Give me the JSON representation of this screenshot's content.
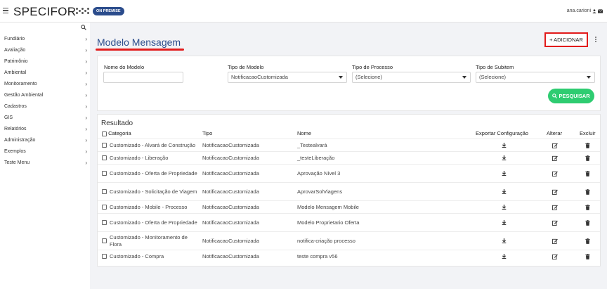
{
  "header": {
    "logo_text": "SPECIFOR",
    "badge": "ON PREMISE",
    "user": "ana.carioni",
    "icons": [
      "menu-icon",
      "user-icon",
      "mail-icon"
    ]
  },
  "sidebar": {
    "items": [
      {
        "label": "Fundiário"
      },
      {
        "label": "Avaliação"
      },
      {
        "label": "Patrimônio"
      },
      {
        "label": "Ambiental"
      },
      {
        "label": "Monitoramento"
      },
      {
        "label": "Gestão Ambiental"
      },
      {
        "label": "Cadastros"
      },
      {
        "label": "GIS"
      },
      {
        "label": "Relatórios"
      },
      {
        "label": "Administração"
      },
      {
        "label": "Exemplos"
      },
      {
        "label": "Teste Menu"
      }
    ]
  },
  "page": {
    "title": "Modelo Mensagem",
    "add_label": "+ ADICIONAR"
  },
  "filters": {
    "nome_label": "Nome do Modelo",
    "nome_value": "",
    "tipo_label": "Tipo de Modelo",
    "tipo_value": "NotificacaoCustomizada",
    "processo_label": "Tipo de Processo",
    "processo_value": "(Selecione)",
    "subitem_label": "Tipo de Subitem",
    "subitem_value": "(Selecione)",
    "search_label": "PESQUISAR"
  },
  "results": {
    "title": "Resultado",
    "columns": {
      "categoria": "Categoria",
      "tipo": "Tipo",
      "nome": "Nome",
      "exportar": "Exportar Configuração",
      "alterar": "Alterar",
      "excluir": "Excluir"
    },
    "rows": [
      {
        "categoria": "Customizado - Alvará de Construção",
        "tipo": "NotificacaoCustomizada",
        "nome": "_Testealvará"
      },
      {
        "categoria": "Customizado - Liberação",
        "tipo": "NotificacaoCustomizada",
        "nome": "_testeLiberação"
      },
      {
        "categoria": "Customizado - Oferta de Propriedade",
        "tipo": "NotificacaoCustomizada",
        "nome": "Aprovação Nível 3"
      },
      {
        "categoria": "Customizado - Solicitação de Viagem",
        "tipo": "NotificacaoCustomizada",
        "nome": "AprovarSolViagens"
      },
      {
        "categoria": "Customizado - Mobile - Processo",
        "tipo": "NotificacaoCustomizada",
        "nome": "Modelo Mensagem Mobile"
      },
      {
        "categoria": "Customizado - Oferta de Propriedade",
        "tipo": "NotificacaoCustomizada",
        "nome": "Modelo Proprietario Oferta"
      },
      {
        "categoria": "Customizado - Monitoramento de Flora",
        "tipo": "NotificacaoCustomizada",
        "nome": "notifica-criação processo"
      },
      {
        "categoria": "Customizado - Compra",
        "tipo": "NotificacaoCustomizada",
        "nome": "teste compra v56"
      }
    ]
  },
  "colors": {
    "brand": "#2b4c8c",
    "accent_red": "#e21b1b",
    "success": "#2ecc71"
  }
}
